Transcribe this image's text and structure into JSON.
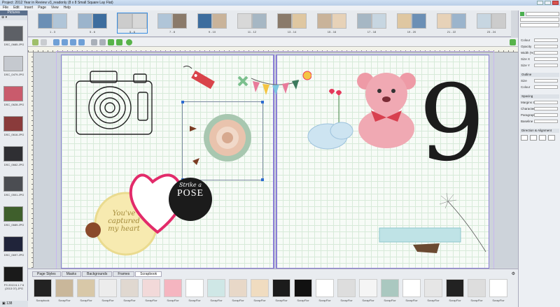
{
  "window": {
    "title": "Project: 2012 Year in Review v3_readonly (8 x 8 Small Square Lay Flat)"
  },
  "menu": [
    "File",
    "Edit",
    "Insert",
    "Page",
    "View",
    "Help"
  ],
  "pictures_panel": {
    "title": "Pictures",
    "images": [
      {
        "caption": "DSC_0685.JPG",
        "color": "#5d6066"
      },
      {
        "caption": "DSC_0479.JPG",
        "color": "#c5c9cf"
      },
      {
        "caption": "DSC_0628.JPG",
        "color": "#c95b6c"
      },
      {
        "caption": "DSC_0616.JPG",
        "color": "#8a3b3b"
      },
      {
        "caption": "DSC_0662.JPG",
        "color": "#2f2f33"
      },
      {
        "caption": "DSC_0501.JPG",
        "color": "#4b4d52"
      },
      {
        "caption": "DSC_0689.JPG",
        "color": "#3f5f2c"
      },
      {
        "caption": "DSC_0697.JPG",
        "color": "#20243a"
      },
      {
        "caption": "FS 2013 6.1.7 6 (2013 07).JPG",
        "color": "#1a1a1a"
      }
    ],
    "count": "138"
  },
  "spreads": [
    {
      "label": "1 - 3"
    },
    {
      "label": "5 - 6"
    },
    {
      "label": "5 - 6"
    },
    {
      "label": "7 - 8"
    },
    {
      "label": "9 - 10"
    },
    {
      "label": "11 - 12"
    },
    {
      "label": "13 - 14"
    },
    {
      "label": "15 - 16"
    },
    {
      "label": "17 - 18"
    },
    {
      "label": "19 - 20"
    },
    {
      "label": "21 - 22"
    },
    {
      "label": "23 - 24"
    }
  ],
  "canvas": {
    "sticker_pose": {
      "line1": "Strike a",
      "line2": "POSE"
    },
    "sticker_heart": {
      "line1": "You've",
      "line2": "captured",
      "line3": "my heart"
    },
    "big_number": "9"
  },
  "bottom_tabs": [
    "Page Styles",
    "Masks",
    "Backgrounds",
    "Frames",
    "Scrapbook"
  ],
  "scrapbook_items": [
    {
      "caption": "Scrapbook"
    },
    {
      "caption": "ScrapFlor"
    },
    {
      "caption": "ScrapFlor"
    },
    {
      "caption": "ScrapFlor"
    },
    {
      "caption": "ScrapFlor"
    },
    {
      "caption": "ScrapFlor"
    },
    {
      "caption": "ScrapFlor"
    },
    {
      "caption": "ScrapFlor"
    },
    {
      "caption": "ScrapFlor"
    },
    {
      "caption": "ScrapFlor"
    },
    {
      "caption": "ScrapFlor"
    },
    {
      "caption": "ScrapFlor"
    },
    {
      "caption": "ScrapFlor"
    },
    {
      "caption": "ScrapFlor"
    },
    {
      "caption": "ScrapFlor"
    },
    {
      "caption": "ScrapFlor"
    },
    {
      "caption": "ScrapFlor"
    },
    {
      "caption": "ScrapFlor"
    },
    {
      "caption": "ScrapFlor"
    },
    {
      "caption": "ScrapFlor"
    },
    {
      "caption": "ScrapFlor"
    },
    {
      "caption": "ScrapFlor"
    }
  ],
  "properties": {
    "rows": [
      "Colour",
      "Opacity",
      "Width (%)",
      "Size X",
      "Size Y"
    ],
    "outline_label": "Outline",
    "outline_rows": [
      "Size",
      "Colour"
    ],
    "spacing_title": "Spacing",
    "spacing_rows": [
      "Margins Size",
      "Character",
      "Paragraph",
      "Baseline"
    ],
    "align_title": "Direction & Alignment"
  }
}
